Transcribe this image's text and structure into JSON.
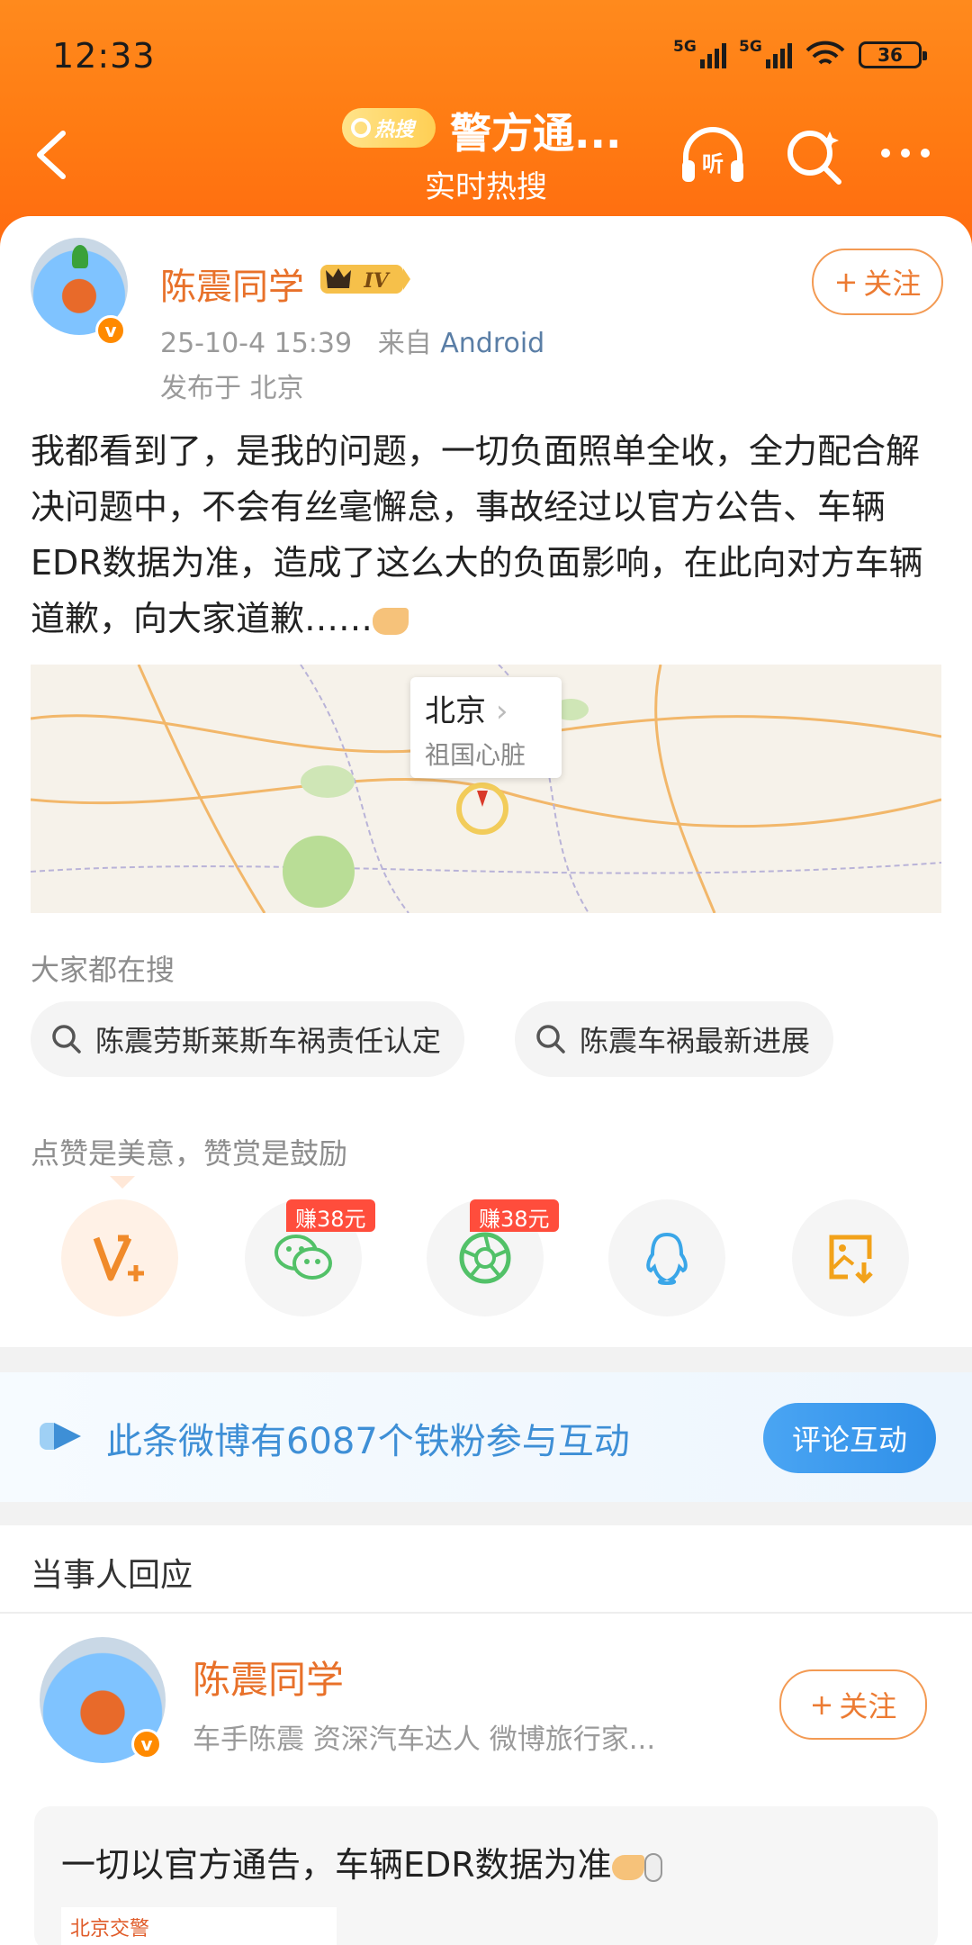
{
  "status_bar": {
    "time": "12:33",
    "network1": "5G",
    "network2": "5G",
    "battery": "36"
  },
  "header": {
    "hot_badge": "热搜",
    "title": "警方通...",
    "subtitle": "实时热搜"
  },
  "post": {
    "username": "陈震同学",
    "level_badge": "IV",
    "follow_label": "关注",
    "timestamp": "25-10-4 15:39",
    "source_prefix": "来自",
    "source": "Android",
    "location": "发布于 北京",
    "text": "我都看到了，是我的问题，一切负面照单全收，全力配合解决问题中，不会有丝毫懈怠，事故经过以官方公告、车辆EDR数据为准，造成了这么大的负面影响，在此向对方车辆道歉，向大家道歉……"
  },
  "map": {
    "city": "北京",
    "desc": "祖国心脏"
  },
  "searches": {
    "title": "大家都在搜",
    "items": [
      "陈震劳斯莱斯车祸责任认定",
      "陈震车祸最新进展"
    ]
  },
  "reward": {
    "title": "点赞是美意，赞赏是鼓励"
  },
  "share": {
    "earn1": "赚38元",
    "earn2": "赚38元",
    "icons": [
      "v-plus-icon",
      "wechat-icon",
      "moments-icon",
      "qq-icon",
      "save-image-icon"
    ]
  },
  "fans": {
    "text": "此条微博有6087个铁粉参与互动",
    "button": "评论互动"
  },
  "response": {
    "section_title": "当事人回应",
    "username": "陈震同学",
    "bio": "车手陈震 资深汽车达人  微博旅行家...",
    "follow_label": "关注",
    "quote": "一切以官方通告，车辆EDR数据为准",
    "thumb_label": "北京交警"
  },
  "colors": {
    "header": "#ff7a12",
    "username": "#e8712a",
    "link": "#3e8fd6",
    "earn": "#ff4d3c"
  }
}
